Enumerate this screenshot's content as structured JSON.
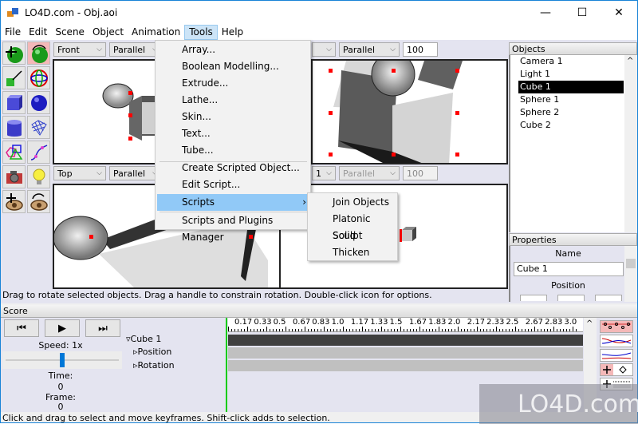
{
  "window": {
    "title": "LO4D.com - Obj.aoi",
    "controls": {
      "minimize": "—",
      "maximize": "☐",
      "close": "✕"
    }
  },
  "menubar": {
    "items": [
      "File",
      "Edit",
      "Scene",
      "Object",
      "Animation",
      "Tools",
      "Help"
    ],
    "active": "Tools"
  },
  "tools_menu": {
    "items": [
      "Array...",
      "Boolean Modelling...",
      "Extrude...",
      "Lathe...",
      "Skin...",
      "Text...",
      "Tube...",
      "Create Scripted Object...",
      "Edit Script...",
      "Scripts",
      "Scripts and Plugins Manager"
    ],
    "highlighted": "Scripts",
    "submenu_arrow": "›"
  },
  "scripts_submenu": {
    "items": [
      "Join Objects",
      "Platonic Solid",
      "Sculpt",
      "Thicken"
    ]
  },
  "toolbox": {
    "tools": [
      "move-tool",
      "rotate-tool",
      "scale-tool",
      "skew-tool",
      "cube-tool",
      "sphere-tool",
      "cylinder-tool",
      "mesh-tool",
      "polygon-tool",
      "curve-tool",
      "camera-tool",
      "light-tool",
      "move-viewpoint-tool",
      "rotate-viewpoint-tool"
    ],
    "selected": "rotate-tool"
  },
  "viewports": [
    {
      "view": "Front",
      "projection": "Parallel",
      "scale": ""
    },
    {
      "view": "",
      "projection": "Parallel",
      "scale": "100"
    },
    {
      "view": "Top",
      "projection": "Parallel",
      "scale": ""
    },
    {
      "view": "1",
      "projection": "Parallel",
      "scale": "100"
    }
  ],
  "objects_panel": {
    "title": "Objects",
    "items": [
      "Camera 1",
      "Light 1",
      "Cube 1",
      "Sphere 1",
      "Sphere 2",
      "Cube 2"
    ],
    "selected": "Cube 1"
  },
  "properties_panel": {
    "title": "Properties",
    "name_label": "Name",
    "name_value": "Cube 1",
    "position_label": "Position"
  },
  "status": {
    "viewport_hint": "Drag to rotate selected objects.  Drag a handle to constrain rotation.  Double-click icon for options.",
    "score_hint": "Click and drag to select and move keyframes.  Shift-click adds to selection."
  },
  "score": {
    "title": "Score",
    "speed_label": "Speed: 1x",
    "speed_value": 0.5,
    "time_label": "Time:",
    "time_value": "0",
    "frame_label": "Frame:",
    "frame_value": "0",
    "tracks": [
      "Cube 1",
      "Position",
      "Rotation"
    ],
    "ruler": [
      "0.17",
      "0.33",
      "0.5",
      "0.67",
      "0.83",
      "1.0",
      "1.17",
      "1.33",
      "1.5",
      "1.67",
      "1.83",
      "2.0",
      "2.17",
      "2.33",
      "2.5",
      "2.67",
      "2.83",
      "3.0"
    ],
    "play_buttons": [
      "skip-back",
      "play",
      "skip-forward"
    ],
    "modes": [
      "keyframe-mode",
      "curve-mode-single",
      "curve-mode-multi",
      "move-keyframe-mode",
      "scale-keyframe-mode"
    ]
  },
  "watermark": "LO4D.com"
}
